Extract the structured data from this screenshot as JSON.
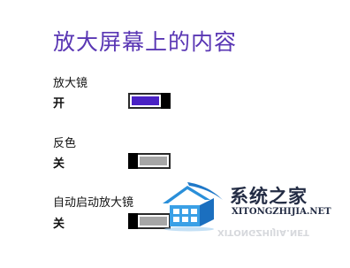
{
  "page": {
    "title": "放大屏幕上的内容"
  },
  "settings": [
    {
      "label": "放大镜",
      "state": "开",
      "on": true
    },
    {
      "label": "反色",
      "state": "关",
      "on": false
    },
    {
      "label": "自动启动放大镜",
      "state": "关",
      "on": false
    }
  ],
  "watermark": {
    "title": "系统之家",
    "url": "XITONGZHIJIA.NET"
  },
  "colors": {
    "title": "#5a37b4",
    "toggle_on": "#4a22c4",
    "toggle_off": "#a6a6a6",
    "thumb": "#000000"
  }
}
